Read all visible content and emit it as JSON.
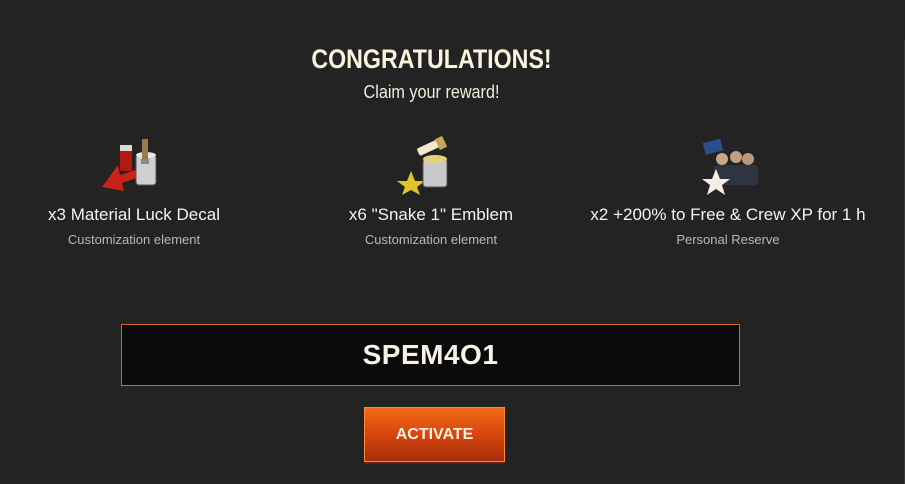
{
  "header": {
    "title": "CONGRATULATIONS!",
    "subtitle": "Claim your reward!"
  },
  "rewards": [
    {
      "name": "x3 Material Luck Decal",
      "type": "Customization element",
      "icon": "decal-paint-icon"
    },
    {
      "name": "x6 \"Snake 1\" Emblem",
      "type": "Customization element",
      "icon": "emblem-paint-icon"
    },
    {
      "name": "x2 +200% to Free & Crew XP for 1 h",
      "type": "Personal Reserve",
      "icon": "crew-reserve-icon"
    }
  ],
  "code": {
    "value": "SPEM4O1"
  },
  "actions": {
    "activate_label": "ACTIVATE"
  },
  "colors": {
    "background": "#232323",
    "accent": "#d2430e",
    "code_border": "#d8622a"
  }
}
